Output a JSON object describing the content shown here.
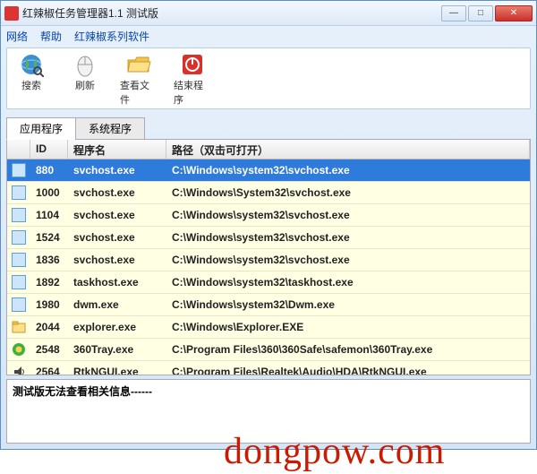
{
  "window": {
    "title": "红辣椒任务管理器1.1 测试版"
  },
  "menu": {
    "net": "网络",
    "help": "帮助",
    "series": "红辣椒系列软件"
  },
  "toolbar": {
    "search": "搜索",
    "refresh": "刷新",
    "viewfile": "查看文件",
    "end": "结束程序"
  },
  "tabs": {
    "app": "应用程序",
    "sys": "系统程序"
  },
  "columns": {
    "icon": "",
    "id": "ID",
    "name": "程序名",
    "path": "路径（双击可打开）"
  },
  "rows": [
    {
      "id": "880",
      "name": "svchost.exe",
      "path": "C:\\Windows\\system32\\svchost.exe",
      "icon": "win",
      "selected": true
    },
    {
      "id": "1000",
      "name": "svchost.exe",
      "path": "C:\\Windows\\System32\\svchost.exe",
      "icon": "win"
    },
    {
      "id": "1104",
      "name": "svchost.exe",
      "path": "C:\\Windows\\system32\\svchost.exe",
      "icon": "win"
    },
    {
      "id": "1524",
      "name": "svchost.exe",
      "path": "C:\\Windows\\system32\\svchost.exe",
      "icon": "win"
    },
    {
      "id": "1836",
      "name": "svchost.exe",
      "path": "C:\\Windows\\system32\\svchost.exe",
      "icon": "win"
    },
    {
      "id": "1892",
      "name": "taskhost.exe",
      "path": "C:\\Windows\\system32\\taskhost.exe",
      "icon": "win"
    },
    {
      "id": "1980",
      "name": "dwm.exe",
      "path": "C:\\Windows\\system32\\Dwm.exe",
      "icon": "win"
    },
    {
      "id": "2044",
      "name": "explorer.exe",
      "path": "C:\\Windows\\Explorer.EXE",
      "icon": "explorer"
    },
    {
      "id": "2548",
      "name": "360Tray.exe",
      "path": "C:\\Program Files\\360\\360Safe\\safemon\\360Tray.exe",
      "icon": "360"
    },
    {
      "id": "2564",
      "name": "RtkNGUI.exe",
      "path": "C:\\Program Files\\Realtek\\Audio\\HDA\\RtkNGUI.exe",
      "icon": "audio"
    }
  ],
  "status": "测试版无法查看相关信息------",
  "watermark": "dongpow.com"
}
